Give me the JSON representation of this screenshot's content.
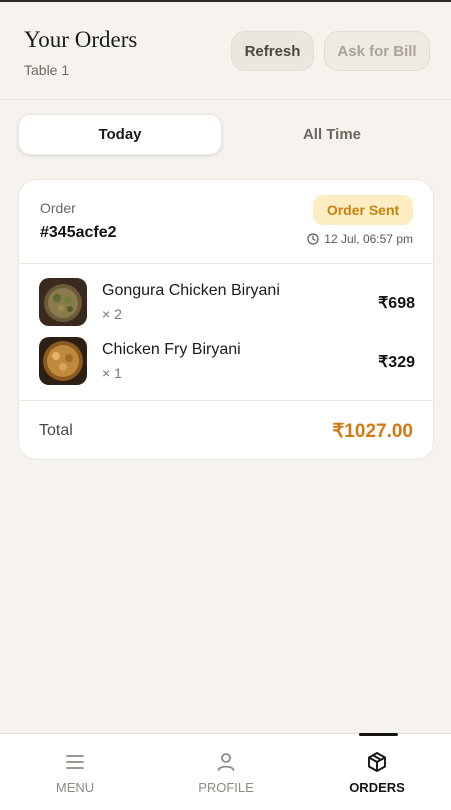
{
  "header": {
    "title": "Your Orders",
    "subtitle": "Table 1",
    "refresh_label": "Refresh",
    "bill_label": "Ask for Bill"
  },
  "tabs": [
    {
      "label": "Today",
      "active": true
    },
    {
      "label": "All Time",
      "active": false
    }
  ],
  "order": {
    "label": "Order",
    "id": "#345acfe2",
    "status": "Order Sent",
    "time": "12 Jul, 06:57 pm",
    "items": [
      {
        "name": "Gongura Chicken Biryani",
        "qty": "× 2",
        "price": "₹698"
      },
      {
        "name": "Chicken Fry Biryani",
        "qty": "× 1",
        "price": "₹329"
      }
    ],
    "total_label": "Total",
    "total_value": "₹1027.00"
  },
  "nav": {
    "items": [
      {
        "label": "MENU",
        "icon": "menu-icon",
        "active": false
      },
      {
        "label": "PROFILE",
        "icon": "user-icon",
        "active": false
      },
      {
        "label": "ORDERS",
        "icon": "box-icon",
        "active": true
      }
    ]
  },
  "colors": {
    "background": "#f6f3ee",
    "accent": "#d27a12",
    "badge_bg": "#fcedc2",
    "badge_text": "#c9800c"
  }
}
